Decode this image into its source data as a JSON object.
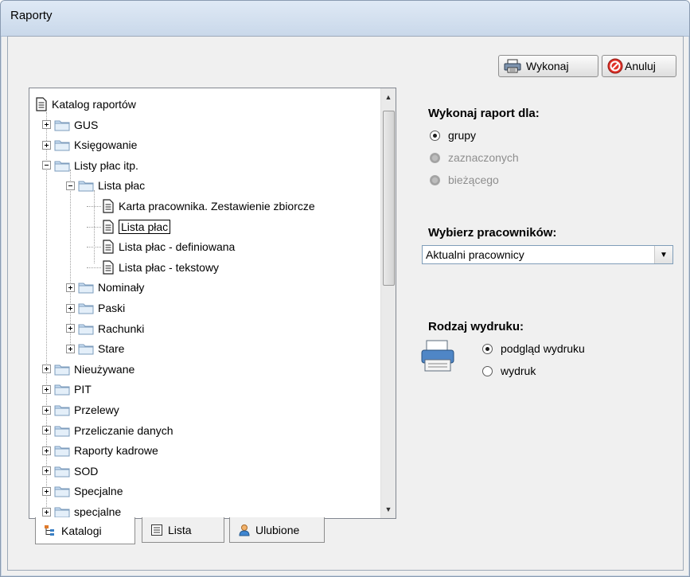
{
  "window": {
    "title": "Raporty"
  },
  "toolbar": {
    "execute_label": "Wykonaj",
    "cancel_label": "Anuluj"
  },
  "tree": {
    "root": "Katalog raportów",
    "items": [
      {
        "label": "GUS",
        "type": "folder",
        "expanded": false
      },
      {
        "label": "Księgowanie",
        "type": "folder",
        "expanded": false
      },
      {
        "label": "Listy płac itp.",
        "type": "folder",
        "expanded": true
      },
      {
        "label": "Lista płac",
        "type": "folder",
        "expanded": true
      },
      {
        "label": "Karta pracownika. Zestawienie zbiorcze",
        "type": "report"
      },
      {
        "label": "Lista płac",
        "type": "report",
        "selected": true
      },
      {
        "label": "Lista płac - definiowana",
        "type": "report"
      },
      {
        "label": "Lista płac - tekstowy",
        "type": "report"
      },
      {
        "label": "Nominały",
        "type": "folder",
        "expanded": false
      },
      {
        "label": "Paski",
        "type": "folder",
        "expanded": false
      },
      {
        "label": "Rachunki",
        "type": "folder",
        "expanded": false
      },
      {
        "label": "Stare",
        "type": "folder",
        "expanded": false
      },
      {
        "label": "Nieużywane",
        "type": "folder",
        "expanded": false
      },
      {
        "label": "PIT",
        "type": "folder",
        "expanded": false
      },
      {
        "label": "Przelewy",
        "type": "folder",
        "expanded": false
      },
      {
        "label": "Przeliczanie danych",
        "type": "folder",
        "expanded": false
      },
      {
        "label": "Raporty kadrowe",
        "type": "folder",
        "expanded": false
      },
      {
        "label": "SOD",
        "type": "folder",
        "expanded": false
      },
      {
        "label": "Specjalne",
        "type": "folder",
        "expanded": false
      },
      {
        "label": "specjalne",
        "type": "folder",
        "expanded": false
      }
    ]
  },
  "tabs": [
    {
      "label": "Katalogi",
      "icon": "hierarchy-icon",
      "active": true
    },
    {
      "label": "Lista",
      "icon": "list-icon",
      "active": false
    },
    {
      "label": "Ulubione",
      "icon": "user-icon",
      "active": false
    }
  ],
  "run_for": {
    "heading": "Wykonaj raport dla:",
    "options": [
      {
        "label": "grupy",
        "checked": true,
        "enabled": true
      },
      {
        "label": "zaznaczonych",
        "checked": false,
        "enabled": false
      },
      {
        "label": "bieżącego",
        "checked": false,
        "enabled": false
      }
    ]
  },
  "employees": {
    "heading": "Wybierz pracowników:",
    "selected": "Aktualni pracownicy"
  },
  "print_type": {
    "heading": "Rodzaj wydruku:",
    "options": [
      {
        "label": "podgląd wydruku",
        "checked": true
      },
      {
        "label": "wydruk",
        "checked": false
      }
    ]
  },
  "colors": {
    "accent": "#f0f0f0",
    "folder": "#b9d4ec",
    "cancel_red": "#e0322a"
  }
}
